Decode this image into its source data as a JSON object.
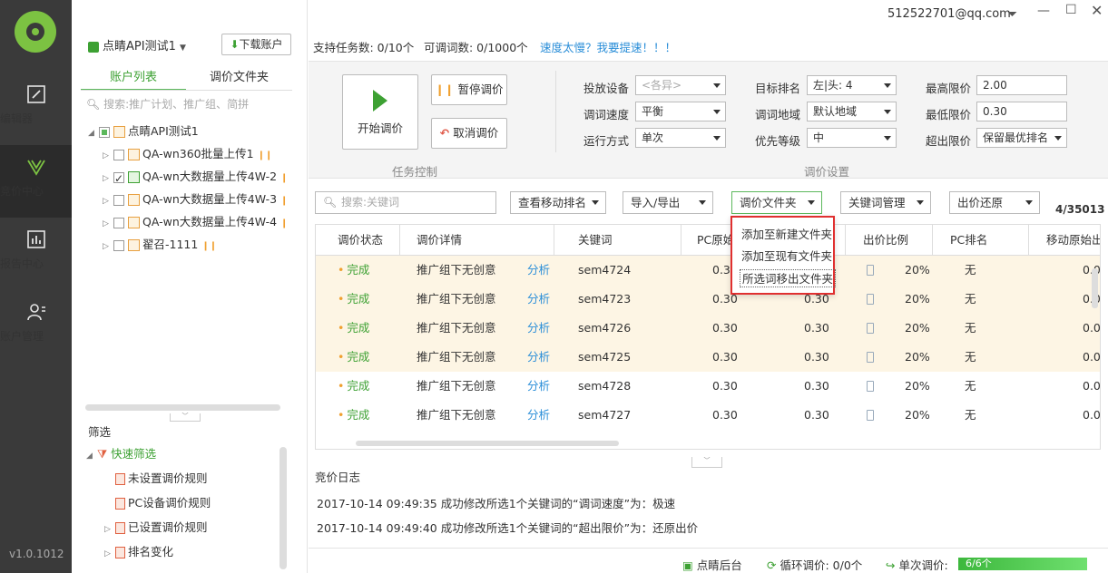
{
  "nav": {
    "items": [
      {
        "label": "编辑器",
        "icon": "edit-icon"
      },
      {
        "label": "竞价中心",
        "icon": "bid-center-icon"
      },
      {
        "label": "报告中心",
        "icon": "report-chart-icon"
      },
      {
        "label": "账户管理",
        "icon": "user-manage-icon"
      }
    ],
    "version": "v1.0.1012"
  },
  "account": {
    "name": "点睛API测试1",
    "download_btn": "下载账户"
  },
  "tree_tabs": [
    "账户列表",
    "调价文件夹"
  ],
  "tree_search_placeholder": "搜索:推广计划、推广组、简拼",
  "tree": {
    "root": "点睛API测试1",
    "children": [
      {
        "label": "QA-wn360批量上传1",
        "checked": false
      },
      {
        "label": "QA-wn大数据量上传4W-2",
        "checked": true
      },
      {
        "label": "QA-wn大数据量上传4W-3",
        "checked": false
      },
      {
        "label": "QA-wn大数据量上传4W-4",
        "checked": false
      },
      {
        "label": "翟召-1111",
        "checked": false
      }
    ]
  },
  "filter": {
    "title": "筛选",
    "quick": "快速筛选",
    "items": [
      "未设置调价规则",
      "PC设备调价规则",
      "已设置调价规则",
      "排名变化"
    ]
  },
  "header": {
    "email": "512522701@qq.com"
  },
  "info": {
    "tasks": "支持任务数: 0/10个",
    "adjustable": "可调词数: 0/1000个",
    "speed_link": "速度太慢？我要提速！！！"
  },
  "task_control": {
    "start": "开始调价",
    "pause": "暂停调价",
    "cancel": "取消调价",
    "section": "任务控制"
  },
  "settings": {
    "section": "调价设置",
    "device_label": "投放设备",
    "device_value": "<各异>",
    "speed_label": "调词速度",
    "speed_value": "平衡",
    "mode_label": "运行方式",
    "mode_value": "单次",
    "rank_label": "目标排名",
    "rank_value": "左|头: 4",
    "region_label": "调词地域",
    "region_value": "默认地域",
    "priority_label": "优先等级",
    "priority_value": "中",
    "max_label": "最高限价",
    "max_value": "2.00",
    "min_label": "最低限价",
    "min_value": "0.30",
    "over_label": "超出限价",
    "over_value": "保留最优排名"
  },
  "toolbar": {
    "search_placeholder": "搜索:关键词",
    "view_rank": "查看移动排名",
    "import_export": "导入/导出",
    "folder": "调价文件夹",
    "kw_manage": "关键词管理",
    "restore": "出价还原",
    "count": "4/35013"
  },
  "menu": {
    "items": [
      "添加至新建文件夹",
      "添加至现有文件夹",
      "所选词移出文件夹"
    ]
  },
  "table": {
    "headers": [
      "调价状态",
      "调价详情",
      "关键词",
      "PC原始",
      "出价比例",
      "PC排名",
      "移动原始出"
    ],
    "rows": [
      {
        "status": "完成",
        "detail": "推广组下无创意",
        "action": "分析",
        "kw": "sem4724",
        "pc": "0.30",
        "mob": "0.30",
        "ratio": "20%",
        "rank": "无",
        "mobile_orig": "0.0",
        "selected": true
      },
      {
        "status": "完成",
        "detail": "推广组下无创意",
        "action": "分析",
        "kw": "sem4723",
        "pc": "0.30",
        "mob": "0.30",
        "ratio": "20%",
        "rank": "无",
        "mobile_orig": "0.0",
        "selected": true
      },
      {
        "status": "完成",
        "detail": "推广组下无创意",
        "action": "分析",
        "kw": "sem4726",
        "pc": "0.30",
        "mob": "0.30",
        "ratio": "20%",
        "rank": "无",
        "mobile_orig": "0.0",
        "selected": true
      },
      {
        "status": "完成",
        "detail": "推广组下无创意",
        "action": "分析",
        "kw": "sem4725",
        "pc": "0.30",
        "mob": "0.30",
        "ratio": "20%",
        "rank": "无",
        "mobile_orig": "0.0",
        "selected": true
      },
      {
        "status": "完成",
        "detail": "推广组下无创意",
        "action": "分析",
        "kw": "sem4728",
        "pc": "0.30",
        "mob": "0.30",
        "ratio": "20%",
        "rank": "无",
        "mobile_orig": "0.0",
        "selected": false
      },
      {
        "status": "完成",
        "detail": "推广组下无创意",
        "action": "分析",
        "kw": "sem4727",
        "pc": "0.30",
        "mob": "0.30",
        "ratio": "20%",
        "rank": "无",
        "mobile_orig": "0.0",
        "selected": false
      }
    ]
  },
  "log": {
    "title": "竞价日志",
    "lines": [
      "2017-10-14 09:49:35 成功修改所选1个关键词的“调词速度”为：极速",
      "2017-10-14 09:49:40 成功修改所选1个关键词的“超出限价”为：还原出价"
    ]
  },
  "statusbar": {
    "backend": "点睛后台",
    "loop": "循环调价: 0/0个",
    "single": "单次调价:",
    "progress_text": "6/6个",
    "progress_fraction": 1.0
  }
}
